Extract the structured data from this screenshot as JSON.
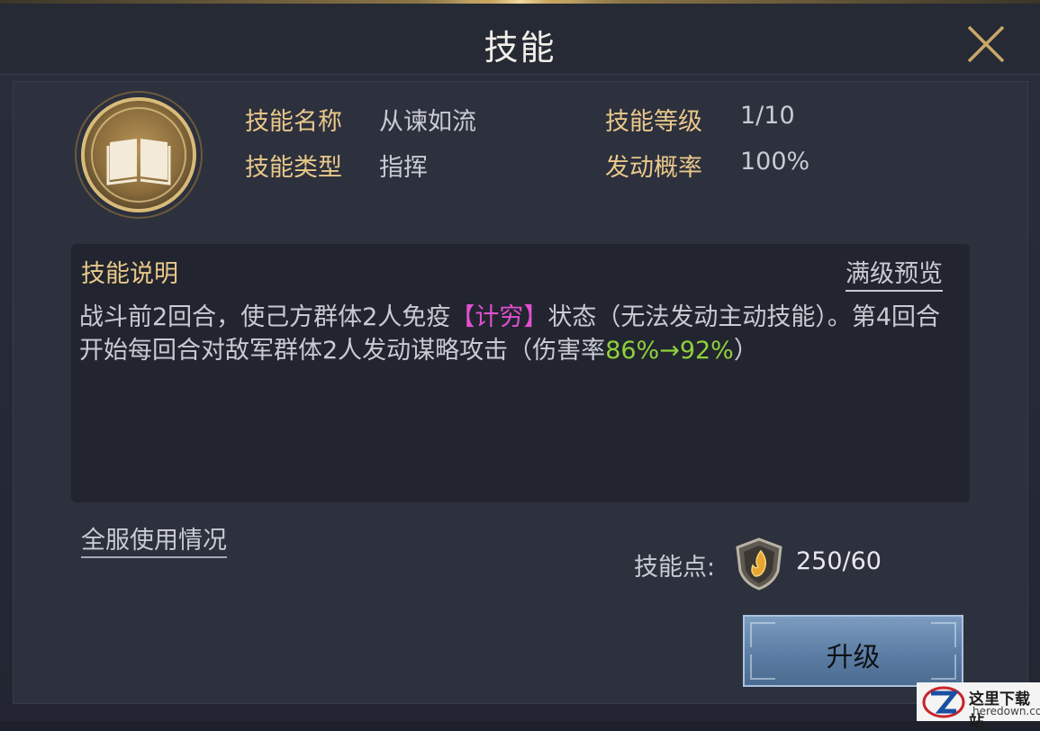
{
  "header": {
    "title": "技能"
  },
  "skill": {
    "name_label": "技能名称",
    "name_value": "从谏如流",
    "level_label": "技能等级",
    "level_value": "1/10",
    "type_label": "技能类型",
    "type_value": "指挥",
    "chance_label": "发动概率",
    "chance_value": "100%"
  },
  "description": {
    "title": "技能说明",
    "preview_link": "满级预览",
    "text_part1": "战斗前2回合，使己方群体2人免疫",
    "text_highlight": "【计穷】",
    "text_part2": "状态（无法发动主动技能）。第4回合开始每回合对敌军群体2人发动谋略攻击（伤害率",
    "text_damage": "86%→92%",
    "text_part3": "）"
  },
  "footer": {
    "usage_link": "全服使用情况",
    "points_label": "技能点:",
    "points_value": "250/60",
    "upgrade_label": "升级"
  },
  "watermark": {
    "main": "这里下载站",
    "sub": "heredown.com"
  },
  "colors": {
    "gold_label": "#e8c88a",
    "highlight_pink": "#e24fd0",
    "highlight_green": "#8fd13c",
    "button_blue": "#5c7ea4"
  },
  "icons": {
    "close": "close-x-icon",
    "skill": "open-book-icon",
    "points": "shield-flame-icon"
  }
}
